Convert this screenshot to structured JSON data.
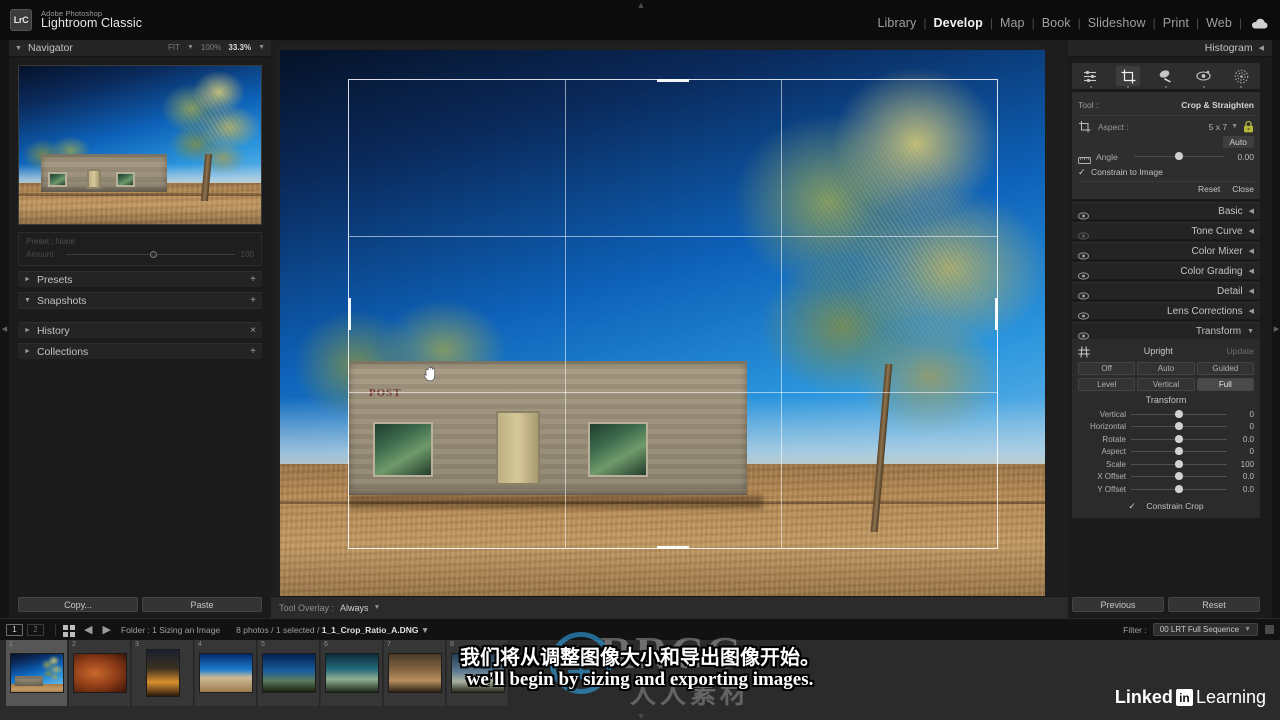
{
  "app": {
    "badge": "LrC",
    "brand_line1": "Adobe Photoshop",
    "brand_line2": "Lightroom Classic"
  },
  "modules": [
    {
      "label": "Library",
      "active": false
    },
    {
      "label": "Develop",
      "active": true
    },
    {
      "label": "Map",
      "active": false
    },
    {
      "label": "Book",
      "active": false
    },
    {
      "label": "Slideshow",
      "active": false
    },
    {
      "label": "Print",
      "active": false
    },
    {
      "label": "Web",
      "active": false
    }
  ],
  "module_separator": "|",
  "cloud_icon": "cloud-icon",
  "left_panel": {
    "navigator": {
      "title": "Navigator",
      "zoom_fit": "FIT",
      "zoom_100": "100%",
      "zoom_current": "33.3%"
    },
    "preset_box": {
      "preset_label": "Preset : None",
      "amount_label": "Amount",
      "amount_value": "100"
    },
    "rows": [
      {
        "label": "Presets",
        "expanded": false,
        "action": "+"
      },
      {
        "label": "Snapshots",
        "expanded": true,
        "action": "+"
      },
      {
        "label": "History",
        "expanded": false,
        "action": "×"
      },
      {
        "label": "Collections",
        "expanded": false,
        "action": "+"
      }
    ],
    "copy_label": "Copy...",
    "paste_label": "Paste"
  },
  "center": {
    "toolbar": {
      "tool_overlay_label": "Tool Overlay :",
      "tool_overlay_value": "Always"
    },
    "photo": {
      "sign_text": "POST"
    },
    "cursor": "hand-cursor"
  },
  "right_panel": {
    "histogram_title": "Histogram",
    "tools": [
      {
        "name": "masking-icon",
        "selected": false
      },
      {
        "name": "crop-overlay-icon",
        "selected": true
      },
      {
        "name": "spot-removal-icon",
        "selected": false
      },
      {
        "name": "red-eye-icon",
        "selected": false
      },
      {
        "name": "radial-filter-icon",
        "selected": false
      }
    ],
    "crop": {
      "tool_label": "Tool :",
      "tool_value": "Crop & Straighten",
      "aspect_label": "Aspect :",
      "aspect_value": "5 x 7",
      "lock_icon": "lock-closed-icon",
      "auto_label": "Auto",
      "angle_label": "Angle",
      "angle_value": "0.00",
      "constrain_label": "Constrain to Image",
      "constrain_checked": true,
      "reset_label": "Reset",
      "close_label": "Close"
    },
    "panels": [
      {
        "label": "Basic",
        "expanded": false,
        "eye": true
      },
      {
        "label": "Tone Curve",
        "expanded": false,
        "eye": false
      },
      {
        "label": "Color Mixer",
        "expanded": false,
        "eye": true
      },
      {
        "label": "Color Grading",
        "expanded": false,
        "eye": true
      },
      {
        "label": "Detail",
        "expanded": false,
        "eye": true
      },
      {
        "label": "Lens Corrections",
        "expanded": false,
        "eye": true
      },
      {
        "label": "Transform",
        "expanded": true,
        "eye": true
      }
    ],
    "transform": {
      "upright_label": "Upright",
      "update_label": "Update",
      "upright_modes_row1": [
        {
          "label": "Off",
          "active": false
        },
        {
          "label": "Auto",
          "active": false
        },
        {
          "label": "Guided",
          "active": false
        }
      ],
      "upright_modes_row2": [
        {
          "label": "Level",
          "active": false
        },
        {
          "label": "Vertical",
          "active": false
        },
        {
          "label": "Full",
          "active": true
        }
      ],
      "section_title": "Transform",
      "sliders": [
        {
          "label": "Vertical",
          "value": "0"
        },
        {
          "label": "Horizontal",
          "value": "0"
        },
        {
          "label": "Rotate",
          "value": "0.0"
        },
        {
          "label": "Aspect",
          "value": "0"
        },
        {
          "label": "Scale",
          "value": "100"
        },
        {
          "label": "X Offset",
          "value": "0.0"
        },
        {
          "label": "Y Offset",
          "value": "0.0"
        }
      ],
      "constrain_crop_label": "Constrain Crop",
      "constrain_crop_checked": true
    },
    "previous_label": "Previous",
    "reset_label": "Reset"
  },
  "filmstrip_bar": {
    "page_1": "1",
    "page_2": "2",
    "grid_icon": "grid-view-icon",
    "back_icon": "arrow-left-icon",
    "forward_icon": "arrow-right-icon",
    "folder_text": "Folder : 1 Sizing an Image",
    "selection_text": "8 photos / 1 selected / ",
    "filename": "1_1_Crop_Ratio_A.DNG",
    "filter_label": "Filter :",
    "filter_value": "00 LRT Full Sequence"
  },
  "filmstrip": {
    "thumbs": [
      {
        "num": "1",
        "selected": true,
        "orientation": "landscape"
      },
      {
        "num": "2",
        "selected": false,
        "orientation": "landscape"
      },
      {
        "num": "3",
        "selected": false,
        "orientation": "portrait"
      },
      {
        "num": "4",
        "selected": false,
        "orientation": "landscape"
      },
      {
        "num": "5",
        "selected": false,
        "orientation": "landscape"
      },
      {
        "num": "6",
        "selected": false,
        "orientation": "landscape"
      },
      {
        "num": "7",
        "selected": false,
        "orientation": "landscape"
      },
      {
        "num": "8",
        "selected": false,
        "orientation": "landscape"
      }
    ]
  },
  "subtitles": {
    "chinese": "我们将从调整图像大小和导出图像开始。",
    "english": "we'll begin by sizing and exporting images."
  },
  "watermark": {
    "mark": "举",
    "text": "RRCG",
    "subtext": "人人素材"
  },
  "logo": {
    "part1": "Linked",
    "badge": "in",
    "part2": "Learning"
  },
  "colors": {
    "panel_bg": "#1b1b1b",
    "panel_row": "#242424",
    "accent_text": "#e8e8e8",
    "crop_line": "#ffffff",
    "selected_tool": "#3d3d3d"
  }
}
